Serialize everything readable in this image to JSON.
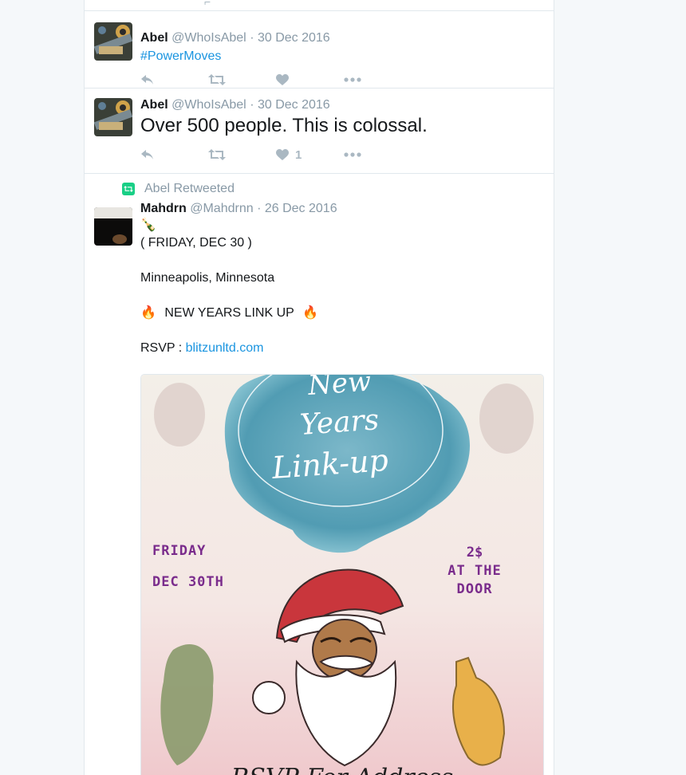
{
  "tweets": [
    {
      "name": "Abel",
      "handle": "@WhoIsAbel",
      "sep": "·",
      "time": "30 Dec 2016",
      "text": "#PowerMoves"
    },
    {
      "name": "Abel",
      "handle": "@WhoIsAbel",
      "sep": "·",
      "time": "30 Dec 2016",
      "text": "Over 500 people. This is colossal.",
      "like_count": "1"
    },
    {
      "retweet_context": "Abel Retweeted",
      "name": "Mahdrn",
      "handle": "@Mahdrnn",
      "sep": "·",
      "time": "26 Dec 2016",
      "emoji": "🍾",
      "line1": "( FRIDAY, DEC 30 )",
      "line2": "Minneapolis, Minnesota",
      "line3_left": "🔥",
      "line3_text": "NEW YEARS LINK UP",
      "line3_right": "🔥",
      "rsvp_label": "RSVP :",
      "rsvp_link": "blitzunltd.com",
      "poster": {
        "title_line1": "New",
        "title_line2": "Years",
        "title_line3": "Link-up",
        "day": "FRIDAY",
        "date": "DEC 30TH",
        "price": "2$",
        "price_line2": "AT THE",
        "price_line3": "DOOR",
        "footer": "RSVP For Address"
      }
    }
  ],
  "icons": {
    "reply": "reply-icon",
    "retweet": "retweet-icon",
    "like": "heart-icon",
    "more": "more-icon"
  },
  "colors": {
    "link": "#1b95e0",
    "retweet_badge": "#19cf86",
    "muted": "#8899a6"
  }
}
